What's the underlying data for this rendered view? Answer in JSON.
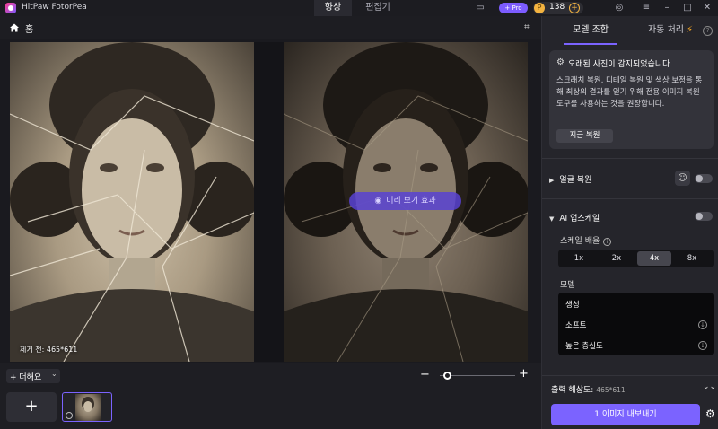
{
  "app": {
    "title": "HitPaw FotorPea"
  },
  "top_tabs": [
    {
      "label": "향상",
      "active": true
    },
    {
      "label": "편집기",
      "active": false
    }
  ],
  "top_bar": {
    "pro_label": "+ Pro",
    "credits": "138",
    "credits_add": "+"
  },
  "breadcrumb": {
    "home_label": "홈"
  },
  "canvas": {
    "preview_label": "미리 보기 효과",
    "size_label": "제거 전: 465*611"
  },
  "bottom": {
    "add_label": "+ 더해요",
    "add_chevron": "⌄",
    "zoom_minus": "−",
    "zoom_plus": "+",
    "zoom_level": 0.1,
    "add_image_label": "+"
  },
  "panel": {
    "tab_combo": "모델 조합",
    "tab_auto": "자동 처리",
    "help": "?",
    "notice": {
      "title": "오래된 사진이 감지되었습니다",
      "description": "스크래치 복원, 디테일 복원 및 색상 보정을 통해 최상의 결과를 얻기 위해 전용 이미지 복원 도구를 사용하는 것을 권장합니다.",
      "button": "지금 복원"
    },
    "face_restore": {
      "label": "얼굴 복원",
      "enabled": false
    },
    "ai_upscale": {
      "label": "AI 업스케일",
      "enabled": false,
      "scale_label": "스케일 배율",
      "scale_options": [
        "1x",
        "2x",
        "4x",
        "8x"
      ],
      "scale_selected": "4x",
      "model_label": "모델",
      "models": [
        "생성",
        "소프트",
        "높은 충실도"
      ]
    },
    "output": {
      "label": "출력 해상도:",
      "size": "465*611"
    },
    "export_label": "1 이미지 내보내기"
  },
  "colors": {
    "accent": "#7b63ff",
    "coin": "#f3b340",
    "bolt": "#f5a623"
  }
}
